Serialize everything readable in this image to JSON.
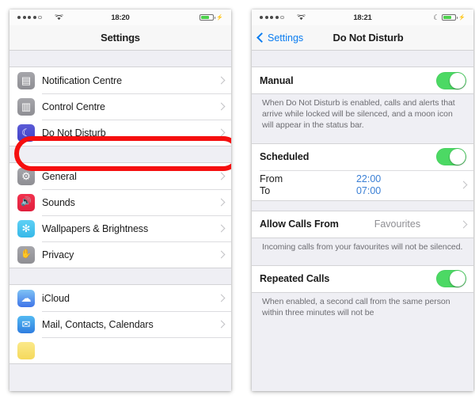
{
  "left_phone": {
    "status_bar": {
      "signal_dots_filled": 4,
      "signal_dots_total": 5,
      "wifi_icon": "wifi-icon",
      "time": "18:20",
      "battery_icon": "battery-icon",
      "battery_level_pct": 70,
      "charging_icon": "lightning-bolt-icon"
    },
    "nav": {
      "title": "Settings"
    },
    "groups": [
      {
        "rows": [
          {
            "label": "Notification Centre",
            "icon": "notification-centre-icon",
            "icon_glyph": "▣",
            "icon_class": "ic-gray",
            "accessory": "chevron"
          },
          {
            "label": "Control Centre",
            "icon": "control-centre-icon",
            "icon_glyph": "▤",
            "icon_class": "ic-gray",
            "accessory": "chevron"
          },
          {
            "label": "Do Not Disturb",
            "icon": "do-not-disturb-icon",
            "icon_glyph": "☽",
            "icon_class": "ic-dnd",
            "accessory": "chevron",
            "highlighted": true
          }
        ]
      },
      {
        "rows": [
          {
            "label": "General",
            "icon": "general-gear-icon",
            "icon_glyph": "⚙",
            "icon_class": "ic-gray",
            "accessory": "chevron"
          },
          {
            "label": "Sounds",
            "icon": "sounds-speaker-icon",
            "icon_glyph": "🔊",
            "icon_class": "ic-red",
            "accessory": "chevron"
          },
          {
            "label": "Wallpapers & Brightness",
            "icon": "wallpapers-brightness-icon",
            "icon_glyph": "✻",
            "icon_class": "ic-cyan",
            "accessory": "chevron"
          },
          {
            "label": "Privacy",
            "icon": "privacy-hand-icon",
            "icon_glyph": "✋",
            "icon_class": "ic-gray",
            "accessory": "chevron"
          }
        ]
      },
      {
        "rows": [
          {
            "label": "iCloud",
            "icon": "icloud-icon",
            "icon_glyph": "☁",
            "icon_class": "ic-icloud",
            "accessory": "chevron"
          },
          {
            "label": "Mail, Contacts, Calendars",
            "icon": "mail-icon",
            "icon_glyph": "✉",
            "icon_class": "ic-mail",
            "accessory": "chevron"
          }
        ]
      }
    ]
  },
  "right_phone": {
    "status_bar": {
      "signal_dots_filled": 4,
      "signal_dots_total": 5,
      "wifi_icon": "wifi-icon",
      "time": "18:21",
      "moon_icon": "crescent-moon-icon",
      "moon_glyph": "☾",
      "battery_icon": "battery-icon",
      "battery_level_pct": 70,
      "charging_icon": "lightning-bolt-icon"
    },
    "nav": {
      "back_label": "Settings",
      "title": "Do Not Disturb"
    },
    "manual": {
      "label": "Manual",
      "toggle_state": "on",
      "footnote": "When Do Not Disturb is enabled, calls and alerts that arrive while locked will be silenced, and a moon icon will appear in the status bar."
    },
    "scheduled": {
      "label": "Scheduled",
      "toggle_state": "on",
      "from_label": "From",
      "from_value": "22:00",
      "to_label": "To",
      "to_value": "07:00"
    },
    "allow_calls": {
      "label": "Allow Calls From",
      "value": "Favourites",
      "footnote": "Incoming calls from your favourites will not be silenced."
    },
    "repeated_calls": {
      "label": "Repeated Calls",
      "toggle_state": "on",
      "footnote": "When enabled, a second call from the same person within three minutes will not be"
    }
  },
  "colors": {
    "highlight_red": "#f50f0f",
    "toggle_green": "#4cd964",
    "link_blue": "#0a7cf0",
    "value_blue": "#3a7fd5",
    "list_bg": "#efeff4"
  }
}
